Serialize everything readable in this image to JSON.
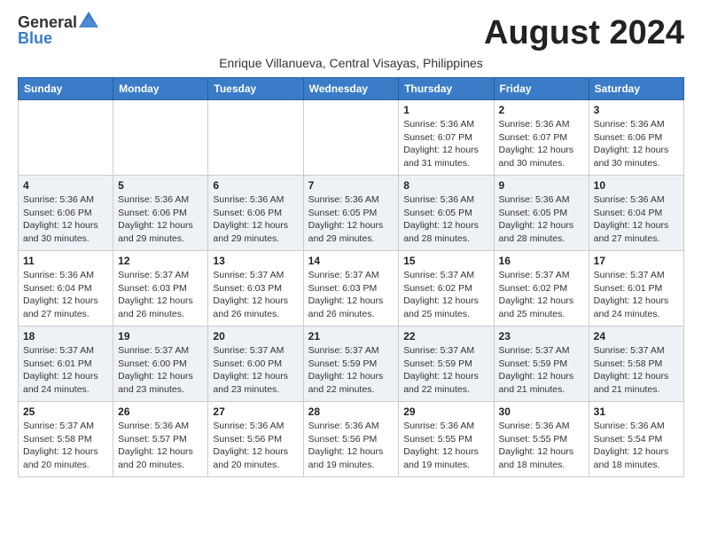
{
  "header": {
    "logo_general": "General",
    "logo_blue": "Blue",
    "month_title": "August 2024",
    "subtitle": "Enrique Villanueva, Central Visayas, Philippines"
  },
  "columns": [
    "Sunday",
    "Monday",
    "Tuesday",
    "Wednesday",
    "Thursday",
    "Friday",
    "Saturday"
  ],
  "weeks": [
    {
      "days": [
        {
          "num": "",
          "info": ""
        },
        {
          "num": "",
          "info": ""
        },
        {
          "num": "",
          "info": ""
        },
        {
          "num": "",
          "info": ""
        },
        {
          "num": "1",
          "info": "Sunrise: 5:36 AM\nSunset: 6:07 PM\nDaylight: 12 hours\nand 31 minutes."
        },
        {
          "num": "2",
          "info": "Sunrise: 5:36 AM\nSunset: 6:07 PM\nDaylight: 12 hours\nand 30 minutes."
        },
        {
          "num": "3",
          "info": "Sunrise: 5:36 AM\nSunset: 6:06 PM\nDaylight: 12 hours\nand 30 minutes."
        }
      ]
    },
    {
      "days": [
        {
          "num": "4",
          "info": "Sunrise: 5:36 AM\nSunset: 6:06 PM\nDaylight: 12 hours\nand 30 minutes."
        },
        {
          "num": "5",
          "info": "Sunrise: 5:36 AM\nSunset: 6:06 PM\nDaylight: 12 hours\nand 29 minutes."
        },
        {
          "num": "6",
          "info": "Sunrise: 5:36 AM\nSunset: 6:06 PM\nDaylight: 12 hours\nand 29 minutes."
        },
        {
          "num": "7",
          "info": "Sunrise: 5:36 AM\nSunset: 6:05 PM\nDaylight: 12 hours\nand 29 minutes."
        },
        {
          "num": "8",
          "info": "Sunrise: 5:36 AM\nSunset: 6:05 PM\nDaylight: 12 hours\nand 28 minutes."
        },
        {
          "num": "9",
          "info": "Sunrise: 5:36 AM\nSunset: 6:05 PM\nDaylight: 12 hours\nand 28 minutes."
        },
        {
          "num": "10",
          "info": "Sunrise: 5:36 AM\nSunset: 6:04 PM\nDaylight: 12 hours\nand 27 minutes."
        }
      ]
    },
    {
      "days": [
        {
          "num": "11",
          "info": "Sunrise: 5:36 AM\nSunset: 6:04 PM\nDaylight: 12 hours\nand 27 minutes."
        },
        {
          "num": "12",
          "info": "Sunrise: 5:37 AM\nSunset: 6:03 PM\nDaylight: 12 hours\nand 26 minutes."
        },
        {
          "num": "13",
          "info": "Sunrise: 5:37 AM\nSunset: 6:03 PM\nDaylight: 12 hours\nand 26 minutes."
        },
        {
          "num": "14",
          "info": "Sunrise: 5:37 AM\nSunset: 6:03 PM\nDaylight: 12 hours\nand 26 minutes."
        },
        {
          "num": "15",
          "info": "Sunrise: 5:37 AM\nSunset: 6:02 PM\nDaylight: 12 hours\nand 25 minutes."
        },
        {
          "num": "16",
          "info": "Sunrise: 5:37 AM\nSunset: 6:02 PM\nDaylight: 12 hours\nand 25 minutes."
        },
        {
          "num": "17",
          "info": "Sunrise: 5:37 AM\nSunset: 6:01 PM\nDaylight: 12 hours\nand 24 minutes."
        }
      ]
    },
    {
      "days": [
        {
          "num": "18",
          "info": "Sunrise: 5:37 AM\nSunset: 6:01 PM\nDaylight: 12 hours\nand 24 minutes."
        },
        {
          "num": "19",
          "info": "Sunrise: 5:37 AM\nSunset: 6:00 PM\nDaylight: 12 hours\nand 23 minutes."
        },
        {
          "num": "20",
          "info": "Sunrise: 5:37 AM\nSunset: 6:00 PM\nDaylight: 12 hours\nand 23 minutes."
        },
        {
          "num": "21",
          "info": "Sunrise: 5:37 AM\nSunset: 5:59 PM\nDaylight: 12 hours\nand 22 minutes."
        },
        {
          "num": "22",
          "info": "Sunrise: 5:37 AM\nSunset: 5:59 PM\nDaylight: 12 hours\nand 22 minutes."
        },
        {
          "num": "23",
          "info": "Sunrise: 5:37 AM\nSunset: 5:59 PM\nDaylight: 12 hours\nand 21 minutes."
        },
        {
          "num": "24",
          "info": "Sunrise: 5:37 AM\nSunset: 5:58 PM\nDaylight: 12 hours\nand 21 minutes."
        }
      ]
    },
    {
      "days": [
        {
          "num": "25",
          "info": "Sunrise: 5:37 AM\nSunset: 5:58 PM\nDaylight: 12 hours\nand 20 minutes."
        },
        {
          "num": "26",
          "info": "Sunrise: 5:36 AM\nSunset: 5:57 PM\nDaylight: 12 hours\nand 20 minutes."
        },
        {
          "num": "27",
          "info": "Sunrise: 5:36 AM\nSunset: 5:56 PM\nDaylight: 12 hours\nand 20 minutes."
        },
        {
          "num": "28",
          "info": "Sunrise: 5:36 AM\nSunset: 5:56 PM\nDaylight: 12 hours\nand 19 minutes."
        },
        {
          "num": "29",
          "info": "Sunrise: 5:36 AM\nSunset: 5:55 PM\nDaylight: 12 hours\nand 19 minutes."
        },
        {
          "num": "30",
          "info": "Sunrise: 5:36 AM\nSunset: 5:55 PM\nDaylight: 12 hours\nand 18 minutes."
        },
        {
          "num": "31",
          "info": "Sunrise: 5:36 AM\nSunset: 5:54 PM\nDaylight: 12 hours\nand 18 minutes."
        }
      ]
    }
  ]
}
